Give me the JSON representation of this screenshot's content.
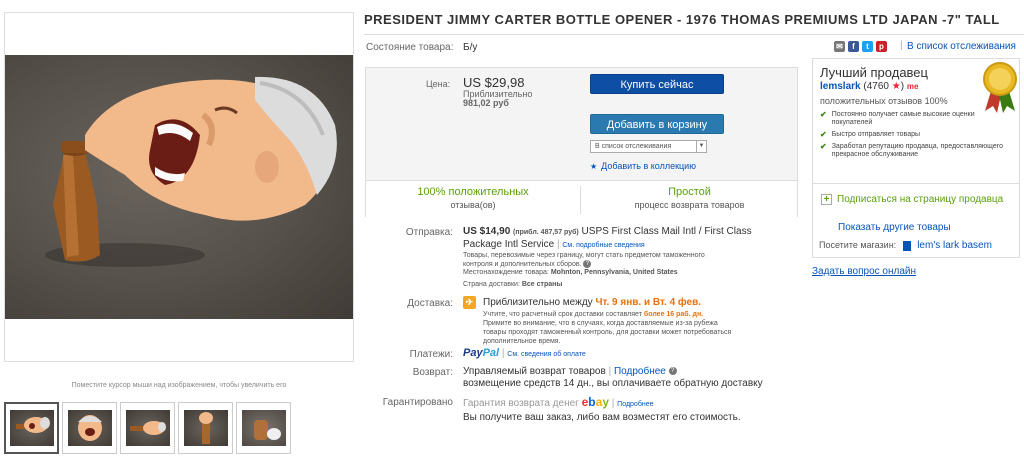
{
  "title": "PRESIDENT JIMMY CARTER BOTTLE OPENER - 1976 THOMAS PREMIUMS LTD JAPAN -7\" TALL",
  "condition": {
    "label": "Состояние товара:",
    "value": "Б/у"
  },
  "share": {
    "icons": [
      "mail-icon",
      "facebook-icon",
      "twitter-icon",
      "pinterest-icon"
    ],
    "separator": "|",
    "watch_link": "В список отслеживания"
  },
  "gallery": {
    "hover_hint": "Поместите курсор мыши над изображением, чтобы увеличить его",
    "thumbnail_count": 5
  },
  "buy_box": {
    "price_label": "Цена:",
    "price": "US $29,98",
    "approx_label": "Приблизительно",
    "approx_value": "981,02 руб",
    "buy_now": "Купить сейчас",
    "add_to_cart": "Добавить в корзину",
    "watch_dropdown": "В список отслеживания",
    "add_collection": "Добавить в коллекцию",
    "positive_big": "100% положительных",
    "positive_small": "отзыва(ов)",
    "returns_big": "Простой",
    "returns_small": "процесс возврата товаров"
  },
  "shipping": {
    "label": "Отправка:",
    "cost": "US $14,90",
    "approx": "(прибл. 487,57 руб)",
    "service_line1": "USPS First Class Mail Intl / First Class",
    "service_line2": "Package Intl Service",
    "sep": "|",
    "details_link": "См. подробные сведения",
    "customs_line1": "Товары, перевозимые через границу, могут стать предметом таможенного",
    "customs_line2": "контроля и дополнительных сборов.",
    "location_label": "Местонахождение товара:",
    "location": "Mohnton, Pennsylvania, United States",
    "ships_to_label": "Страна доставки:",
    "ships_to": "Все страны"
  },
  "delivery": {
    "label": "Доставка:",
    "prefix": "Приблизительно между",
    "dates": "Чт. 9 янв. и Вт. 4 фев.",
    "line2_a": "Учтите, что расчетный срок доставки составляет",
    "line2_b": "более 16 раб. дн.",
    "line3": "Примите во внимание, что в случаях, когда доставляемые из-за рубежа",
    "line4": "товары проходят таможенный контроль, для доставки может потребоваться",
    "line5": "дополнительное время."
  },
  "payments": {
    "label": "Платежи:",
    "paypal_a": "Pay",
    "paypal_b": "Pal",
    "sep": "|",
    "details_link": "См. сведения об оплате"
  },
  "returns": {
    "label": "Возврат:",
    "line1": "Управляемый возврат товаров",
    "sep": "|",
    "more_link": "Подробнее",
    "line2": "возмещение средств 14 дн., вы оплачиваете обратную доставку"
  },
  "guarantee": {
    "label": "Гарантировано",
    "text": "Гарантия возврата денег",
    "ebay": [
      "e",
      "b",
      "a",
      "y"
    ],
    "sep": "|",
    "more_link": "Подробнее",
    "line2": "Вы получите ваш заказ, либо вам возместят его стоимость."
  },
  "seller": {
    "title": "Лучший продавец",
    "name": "lemslark",
    "feedback": "(4760",
    "star": "★",
    "close": ")",
    "me": "me",
    "positive": "положительных отзывов 100%",
    "perks": [
      "Постоянно получает самые высокие оценки покупателей",
      "Быстро отправляет товары",
      "Заработал репутацию продавца, предоставляющего прекрасное обслуживание"
    ],
    "follow": "Подписаться на страницу продавца",
    "other_items": "Показать другие товары",
    "visit_shop_label": "Посетите магазин:",
    "shop_name": "lem's lark basem"
  },
  "ask_question": "Задать вопрос онлайн",
  "colors": {
    "buy_now": "#0e4ea4",
    "add_to_cart": "#2a7ab0",
    "link": "#0654ba",
    "positive_green": "#5ba00e",
    "delivery_orange": "#e8700c"
  }
}
